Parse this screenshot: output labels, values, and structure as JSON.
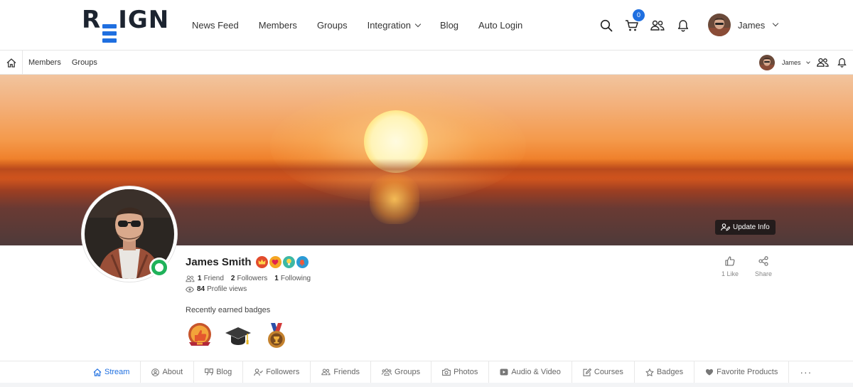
{
  "header": {
    "logo": "REIGN",
    "nav": [
      "News Feed",
      "Members",
      "Groups",
      "Integration",
      "Blog",
      "Auto Login"
    ],
    "cart_count": "0",
    "user_name": "James"
  },
  "subheader": {
    "nav": [
      "Members",
      "Groups"
    ],
    "user_name": "James"
  },
  "cover": {
    "update_label": "Update Info"
  },
  "profile": {
    "name": "James Smith",
    "friends_count": "1",
    "friends_label": "Friend",
    "followers_count": "2",
    "followers_label": "Followers",
    "following_count": "1",
    "following_label": "Following",
    "views_count": "84",
    "views_label": "Profile views",
    "recent_badges_title": "Recently earned badges",
    "like_label": "1 Like",
    "share_label": "Share"
  },
  "tabs": [
    "Stream",
    "About",
    "Blog",
    "Followers",
    "Friends",
    "Groups",
    "Photos",
    "Audio & Video",
    "Courses",
    "Badges",
    "Favorite Products"
  ],
  "more_label": "···",
  "colors": {
    "accent": "#1f6fe0",
    "online": "#1fb25a",
    "logo_dark": "#1c2430"
  }
}
